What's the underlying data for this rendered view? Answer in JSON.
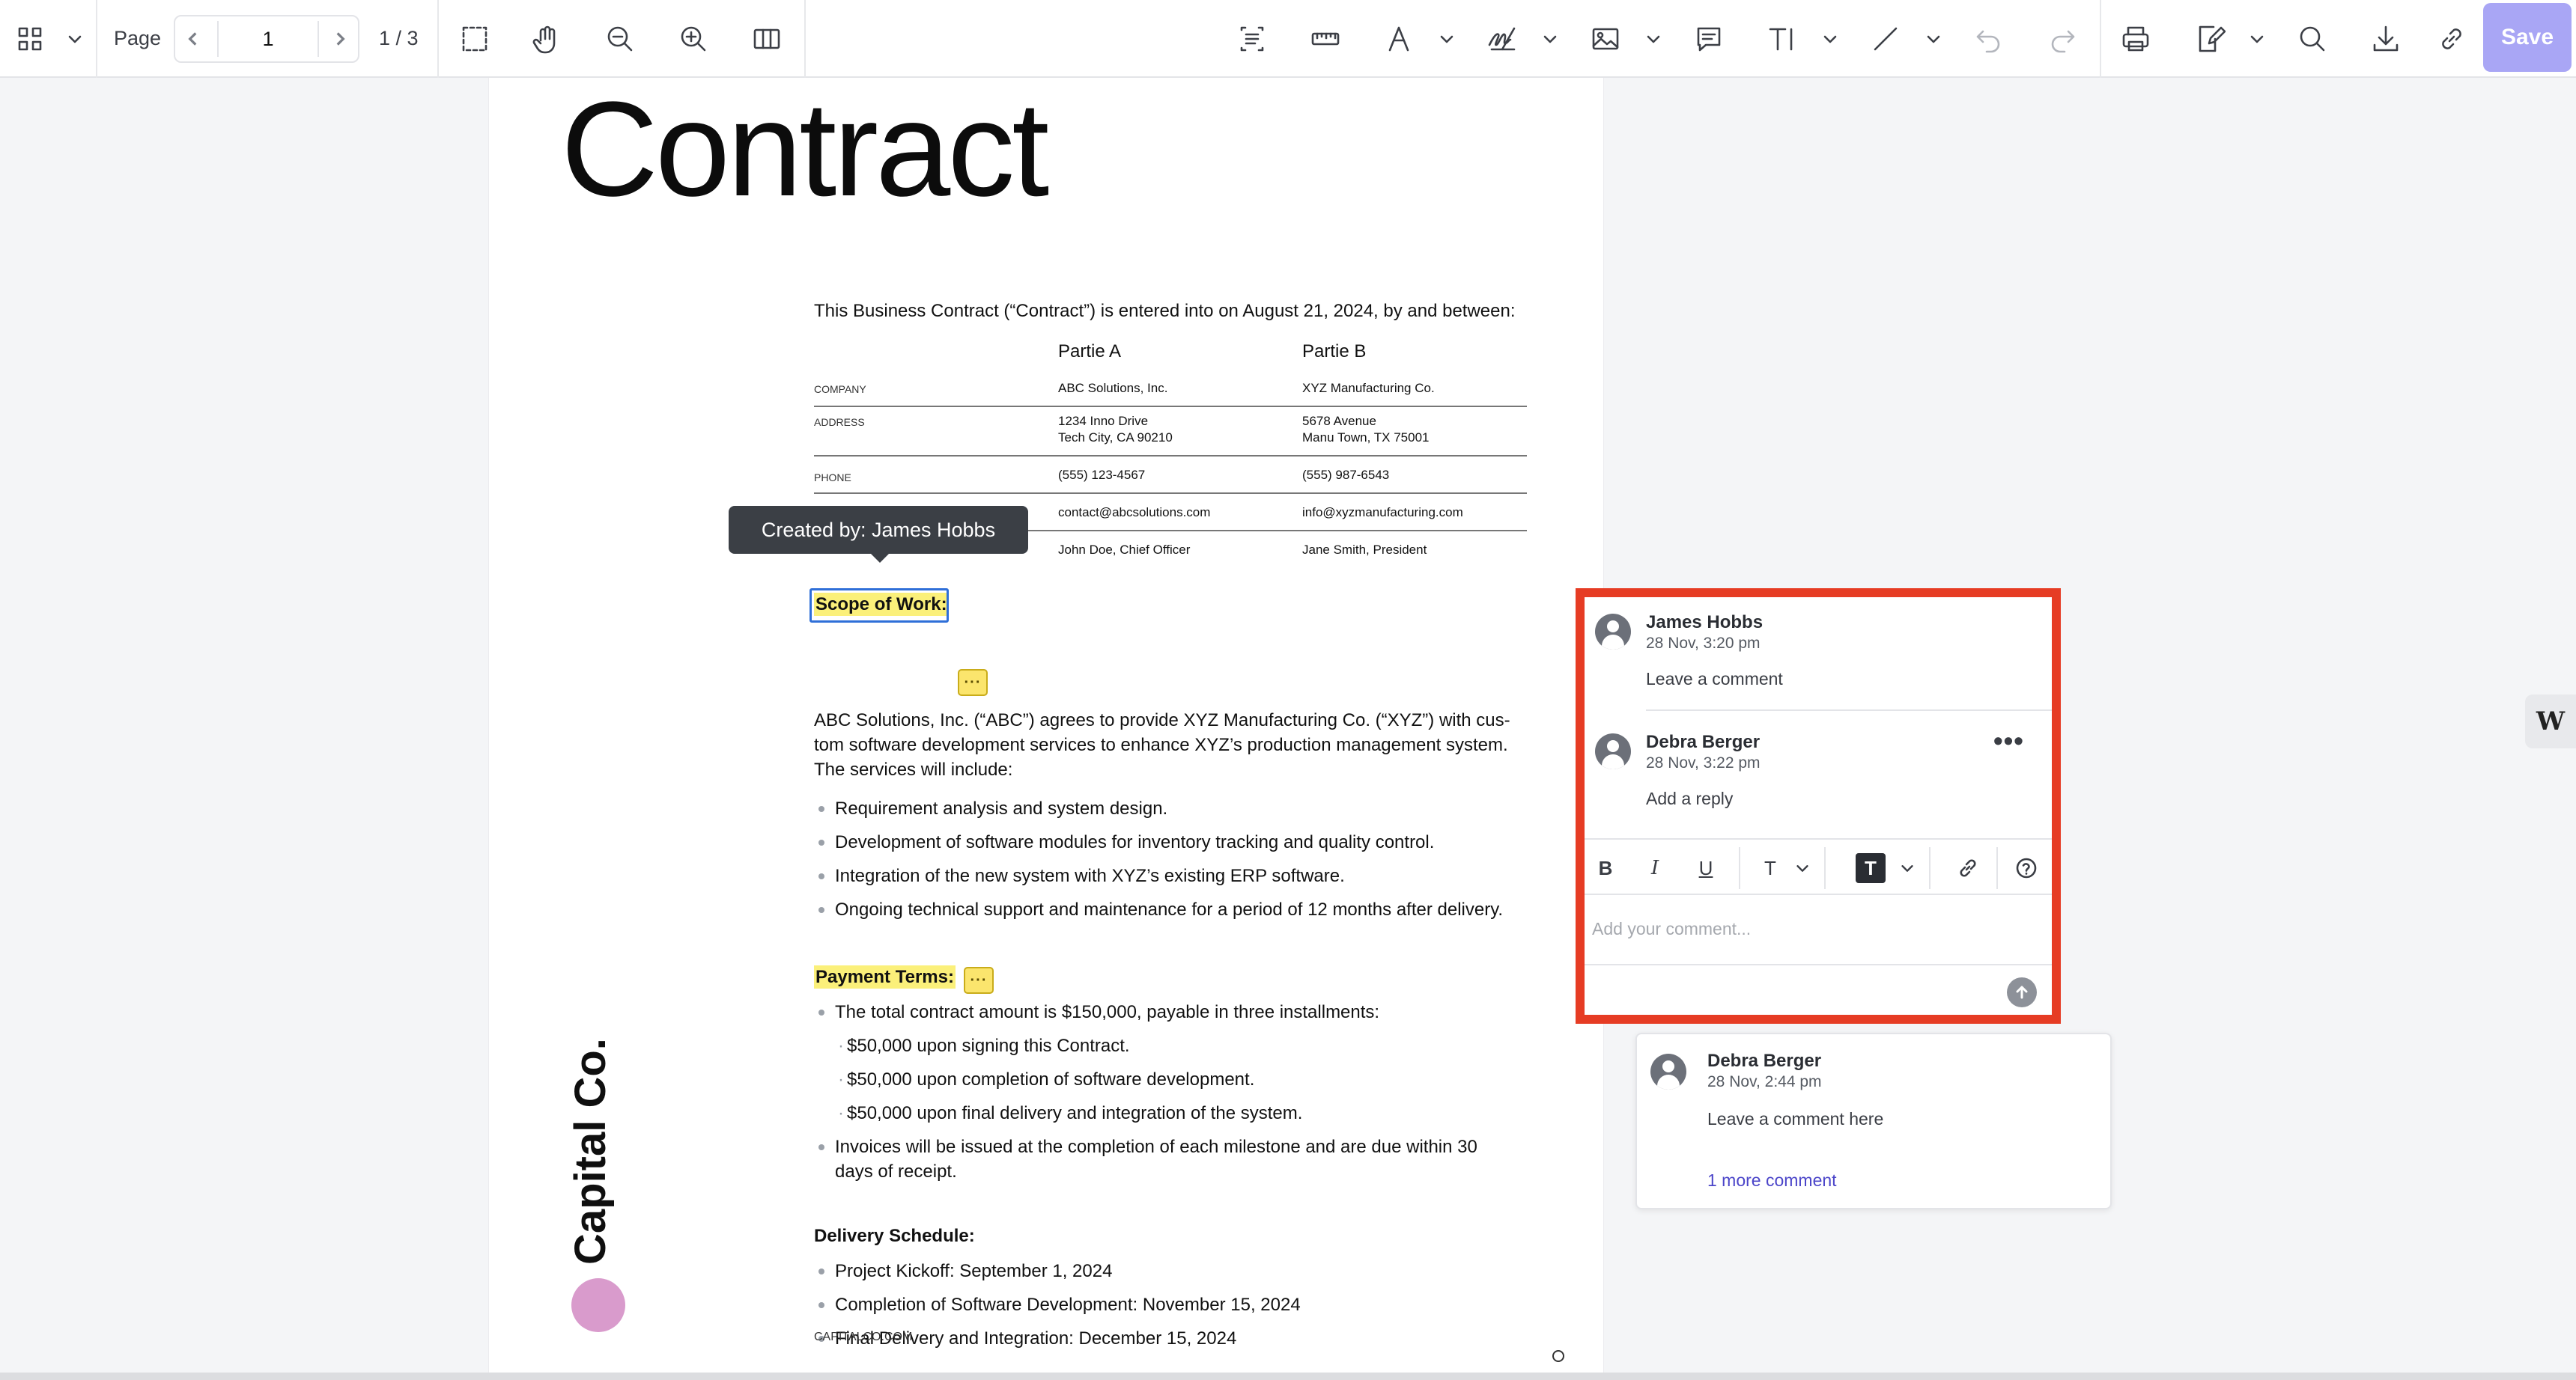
{
  "toolbar": {
    "page_label": "Page",
    "current_page": "1",
    "page_count": "1 / 3",
    "save_label": "Save",
    "icons": [
      "grid-icon",
      "chevron-down-icon",
      "chevron-left-icon",
      "chevron-right-icon",
      "marquee-select-icon",
      "hand-pan-icon",
      "zoom-out-icon",
      "zoom-in-icon",
      "page-layout-icon",
      "text-select-icon",
      "ruler-icon",
      "pen-icon",
      "signature-icon",
      "image-icon",
      "comment-icon",
      "text-tool-icon",
      "line-icon",
      "undo-icon",
      "redo-icon",
      "print-icon",
      "edit-icon",
      "search-icon",
      "download-icon",
      "link-icon"
    ]
  },
  "document": {
    "title": "Contract",
    "intro": "This Business Contract (“Contract”) is entered into on August 21, 2024, by and between:",
    "parties": {
      "a_header": "Partie A",
      "b_header": "Partie B",
      "rows": [
        {
          "label": "COMPANY",
          "a": "ABC Solutions, Inc.",
          "b": "XYZ Manufacturing Co."
        },
        {
          "label": "ADDRESS",
          "a": "1234 Inno Drive",
          "a2": "Tech City, CA 90210",
          "b": "5678 Avenue",
          "b2": "Manu Town, TX 75001"
        },
        {
          "label": "PHONE",
          "a": "(555) 123-4567",
          "b": "(555) 987-6543"
        },
        {
          "label": "",
          "a": "contact@abcsolutions.com",
          "b": "info@xyzmanufacturing.com"
        },
        {
          "label": "",
          "a": "John Doe, Chief Officer",
          "b": "Jane Smith, President"
        }
      ]
    },
    "tooltip": "Created by: James Hobbs",
    "scope": {
      "heading": "Scope of Work:",
      "para_line1": "ABC Solutions, Inc. (“ABC”) agrees to provide XYZ Manufacturing Co. (“XYZ”) with cus-",
      "para_line2": "tom software development services to enhance XYZ’s production management system.",
      "para_line3": "The services will include:",
      "bullets": [
        "Requirement analysis and system design.",
        "Development of software modules for inventory tracking and quality control.",
        "Integration of the new system with XYZ’s existing ERP software.",
        "Ongoing technical support and maintenance for a period of 12 months after delivery."
      ]
    },
    "payment": {
      "heading": "Payment Terms:",
      "bullet1": "The total contract amount is $150,000, payable in three installments:",
      "subs": [
        "$50,000 upon signing this Contract.",
        "$50,000 upon completion of software development.",
        "$50,000 upon final delivery and integration of the system."
      ],
      "bullet2_line1": "Invoices will be issued at the completion of each milestone and are due within 30",
      "bullet2_line2": "days of receipt."
    },
    "delivery": {
      "heading": "Delivery Schedule:",
      "bullets": [
        "Project Kickoff: September 1, 2024",
        "Completion of Software Development: November 15, 2024",
        "Final Delivery and Integration: December 15, 2024"
      ]
    },
    "brand": "Capital Co.",
    "footer_url": "CAPITALCO.COM"
  },
  "comment_thread": {
    "comments": [
      {
        "author": "James Hobbs",
        "time": "28 Nov, 3:20 pm",
        "text": "Leave a comment"
      },
      {
        "author": "Debra Berger",
        "time": "28 Nov, 3:22 pm",
        "text": "Add a reply"
      }
    ],
    "more_options": "•••",
    "formatting": {
      "bold": "B",
      "italic": "I",
      "underline": "U",
      "text_size": "T",
      "text_color": "T",
      "help": "?"
    },
    "reply_placeholder": "Add your comment..."
  },
  "comment_card_2": {
    "author": "Debra Berger",
    "time": "28 Nov, 2:44 pm",
    "text": "Leave a comment here",
    "more_link": "1 more comment"
  },
  "side_widget": "W",
  "colors": {
    "save_bg": "#a9a6f5",
    "highlight": "#fbf07a",
    "thread_border": "#e63c24",
    "link": "#4b45c9",
    "brand_dot": "#d99bcc"
  }
}
